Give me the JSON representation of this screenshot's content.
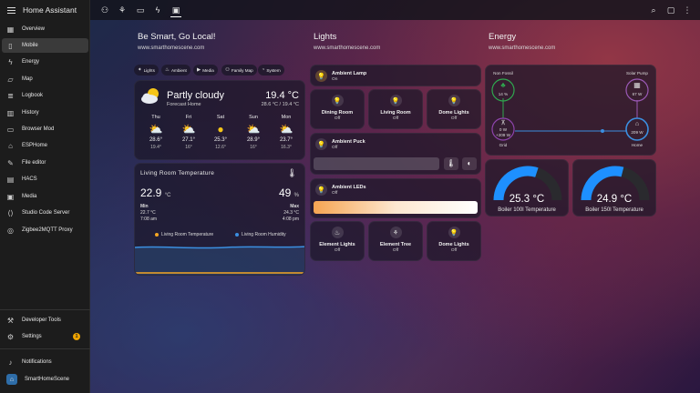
{
  "app": {
    "title": "Home Assistant"
  },
  "sidebar": {
    "items": [
      {
        "label": "Overview",
        "icon": "dashboard-icon"
      },
      {
        "label": "Mobile",
        "icon": "mobile-icon"
      },
      {
        "label": "Energy",
        "icon": "lightning-icon"
      },
      {
        "label": "Map",
        "icon": "map-icon"
      },
      {
        "label": "Logbook",
        "icon": "logbook-icon"
      },
      {
        "label": "History",
        "icon": "history-icon"
      },
      {
        "label": "Browser Mod",
        "icon": "browser-icon"
      },
      {
        "label": "ESPHome",
        "icon": "esphome-icon"
      },
      {
        "label": "File editor",
        "icon": "wrench-icon"
      },
      {
        "label": "HACS",
        "icon": "hacs-icon"
      },
      {
        "label": "Media",
        "icon": "media-icon"
      },
      {
        "label": "Studio Code Server",
        "icon": "code-icon"
      },
      {
        "label": "Zigbee2MQTT Proxy",
        "icon": "zigbee-icon"
      }
    ],
    "bottom": [
      {
        "label": "Developer Tools",
        "icon": "hammer-icon"
      },
      {
        "label": "Settings",
        "icon": "gear-icon",
        "badge": "1"
      },
      {
        "label": "Notifications",
        "icon": "bell-icon"
      },
      {
        "label": "SmartHomeScene",
        "icon": "user-avatar-icon"
      }
    ]
  },
  "topbar": {
    "tabs": [
      "people-icon",
      "tree-icon",
      "tv-icon",
      "lightning-icon",
      "monitor-icon"
    ],
    "actions": [
      "search-icon",
      "assist-icon",
      "more-icon"
    ]
  },
  "columns": {
    "home": {
      "title": "Be Smart, Go Local!",
      "url": "www.smarthomescene.com"
    },
    "lights": {
      "title": "Lights",
      "url": "www.smarthomescene.com"
    },
    "energy": {
      "title": "Energy",
      "url": "www.smarthomescene.com"
    }
  },
  "chips": [
    "Lights",
    "Ambient",
    "Media",
    "Family Map",
    "System"
  ],
  "weather": {
    "condition": "Partly cloudy",
    "location": "Forecast Home",
    "temp": "19.4 °C",
    "range": "28.6 °C / 19.4 °C",
    "forecast": [
      {
        "day": "Thu",
        "icon": "partly-cloudy-icon",
        "high": "28.6°",
        "low": "19.4°"
      },
      {
        "day": "Fri",
        "icon": "partly-cloudy-icon",
        "high": "27.1°",
        "low": "16°"
      },
      {
        "day": "Sat",
        "icon": "sunny-icon",
        "high": "25.3°",
        "low": "12.6°"
      },
      {
        "day": "Sun",
        "icon": "partly-cloudy-icon",
        "high": "28.9°",
        "low": "16°"
      },
      {
        "day": "Mon",
        "icon": "partly-cloudy-icon",
        "high": "23.7°",
        "low": "16.3°"
      }
    ]
  },
  "room_graph": {
    "title": "Living Room Temperature",
    "temp_value": "22.9",
    "temp_unit": "°C",
    "humidity_value": "49",
    "humidity_unit": "%",
    "min_label": "Min",
    "min_value": "22.7 °C",
    "min_time": "7:08 am",
    "max_label": "Max",
    "max_value": "24.3 °C",
    "max_time": "4:08 pm",
    "legend_temp": "Living Room Temperature",
    "legend_hum": "Living Room Humidity",
    "colors": {
      "temp": "#f5a623",
      "hum": "#3b8fe0"
    }
  },
  "lights": {
    "ambient_lamp": {
      "name": "Ambient Lamp",
      "state": "On"
    },
    "row1": [
      {
        "name": "Dining Room",
        "state": "Off"
      },
      {
        "name": "Living Room",
        "state": "Off"
      },
      {
        "name": "Dome Lights",
        "state": "Off"
      }
    ],
    "ambient_puck": {
      "name": "Ambient Puck",
      "state": "Off"
    },
    "ambient_leds": {
      "name": "Ambient LEDs",
      "state": "Off"
    },
    "row2": [
      {
        "name": "Element Lights",
        "state": "Off"
      },
      {
        "name": "Element Tree",
        "state": "Off"
      },
      {
        "name": "Dome Lights",
        "state": "Off"
      }
    ]
  },
  "energy": {
    "non_fossil": {
      "label": "Non Fossil",
      "value": "14 %"
    },
    "solar": {
      "label": "Solar Pump",
      "value": "67 W"
    },
    "grid": {
      "label": "Grid",
      "in": "0 W",
      "out": "+209 W"
    },
    "home": {
      "label": "Home",
      "value": "209 W"
    },
    "boilers": [
      {
        "value": "25.3 °C",
        "label": "Boiler 100l Temperature",
        "fraction": 0.6
      },
      {
        "value": "24.9 °C",
        "label": "Boiler 150l Temperature",
        "fraction": 0.58
      }
    ],
    "colors": {
      "gauge": "#1e90ff",
      "non_fossil": "#2fa84f",
      "solar": "#9b59b6",
      "home": "#3b8fe0"
    }
  }
}
